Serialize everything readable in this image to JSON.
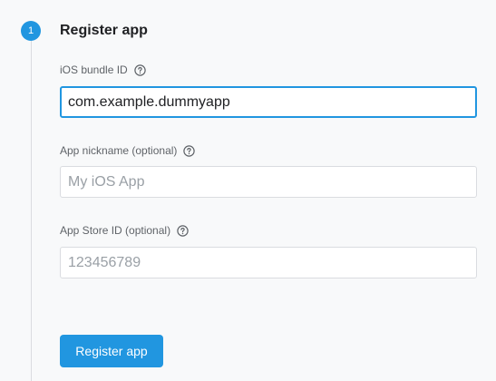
{
  "step": {
    "number": "1",
    "title": "Register app"
  },
  "fields": [
    {
      "label": "iOS bundle ID",
      "value": "com.example.dummyapp",
      "placeholder": "",
      "focused": true,
      "help_icon": "help-circle-icon"
    },
    {
      "label": "App nickname (optional)",
      "value": "",
      "placeholder": "My iOS App",
      "focused": false,
      "help_icon": "help-circle-icon"
    },
    {
      "label": "App Store ID (optional)",
      "value": "",
      "placeholder": "123456789",
      "focused": false,
      "help_icon": "help-circle-icon"
    }
  ],
  "actions": {
    "register_label": "Register app"
  },
  "colors": {
    "accent": "#2196e0",
    "background": "#f8f9fa",
    "label": "#5f6368",
    "border": "#dadce0"
  }
}
